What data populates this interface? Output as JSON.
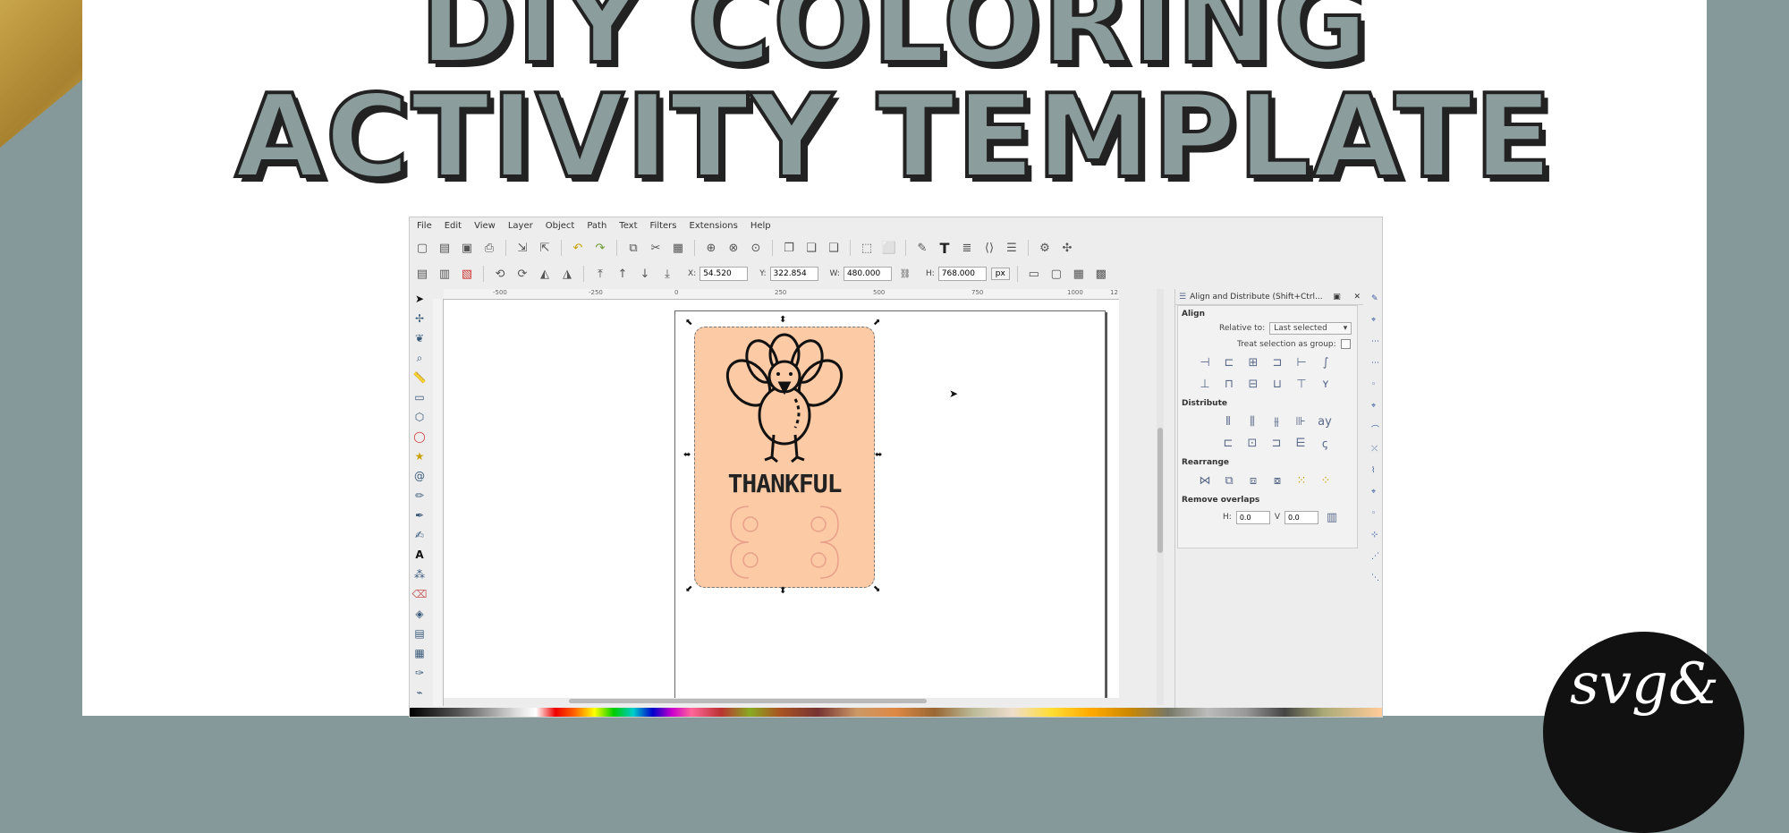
{
  "title": {
    "line1": "DIY COLORING",
    "line2": "ACTIVITY TEMPLATE"
  },
  "logo": {
    "text": "svg&"
  },
  "app": {
    "menu": [
      "File",
      "Edit",
      "View",
      "Layer",
      "Object",
      "Path",
      "Text",
      "Filters",
      "Extensions",
      "Help"
    ],
    "toolbar1_icons": [
      "new-icon",
      "open-icon",
      "save-icon",
      "print-icon",
      "import-icon",
      "export-icon",
      "undo-icon",
      "redo-icon",
      "copy-icon",
      "cut-icon",
      "paste-icon",
      "zoom-selection-icon",
      "zoom-drawing-icon",
      "zoom-page-icon",
      "duplicate-icon",
      "clone-icon",
      "unlink-icon",
      "group-icon",
      "ungroup-icon",
      "node-editor-icon",
      "text-icon",
      "layers-icon",
      "xml-editor-icon",
      "align-icon",
      "preferences-icon",
      "document-properties-icon"
    ],
    "coords": {
      "x_label": "X:",
      "x": "54.520",
      "y_label": "Y:",
      "y": "322.854",
      "w_label": "W:",
      "w": "480.000",
      "h_label": "H:",
      "h": "768.000",
      "unit": "px"
    },
    "ruler_ticks": [
      "-500",
      "-250",
      "0",
      "250",
      "500",
      "750",
      "1000",
      "12"
    ],
    "card_text": "THANKFUL",
    "colors": {
      "card": "#fccaa5",
      "background": "#86999a",
      "title_fill": "#8b9d9c"
    }
  },
  "dock": {
    "title": "Align and Distribute (Shift+Ctrl...",
    "align_label": "Align",
    "relative_to_label": "Relative to:",
    "relative_to_value": "Last selected",
    "treat_group_label": "Treat selection as group:",
    "distribute_label": "Distribute",
    "rearrange_label": "Rearrange",
    "remove_overlaps_label": "Remove overlaps",
    "h_label": "H:",
    "h_value": "0.0",
    "v_label": "V",
    "v_value": "0.0"
  }
}
